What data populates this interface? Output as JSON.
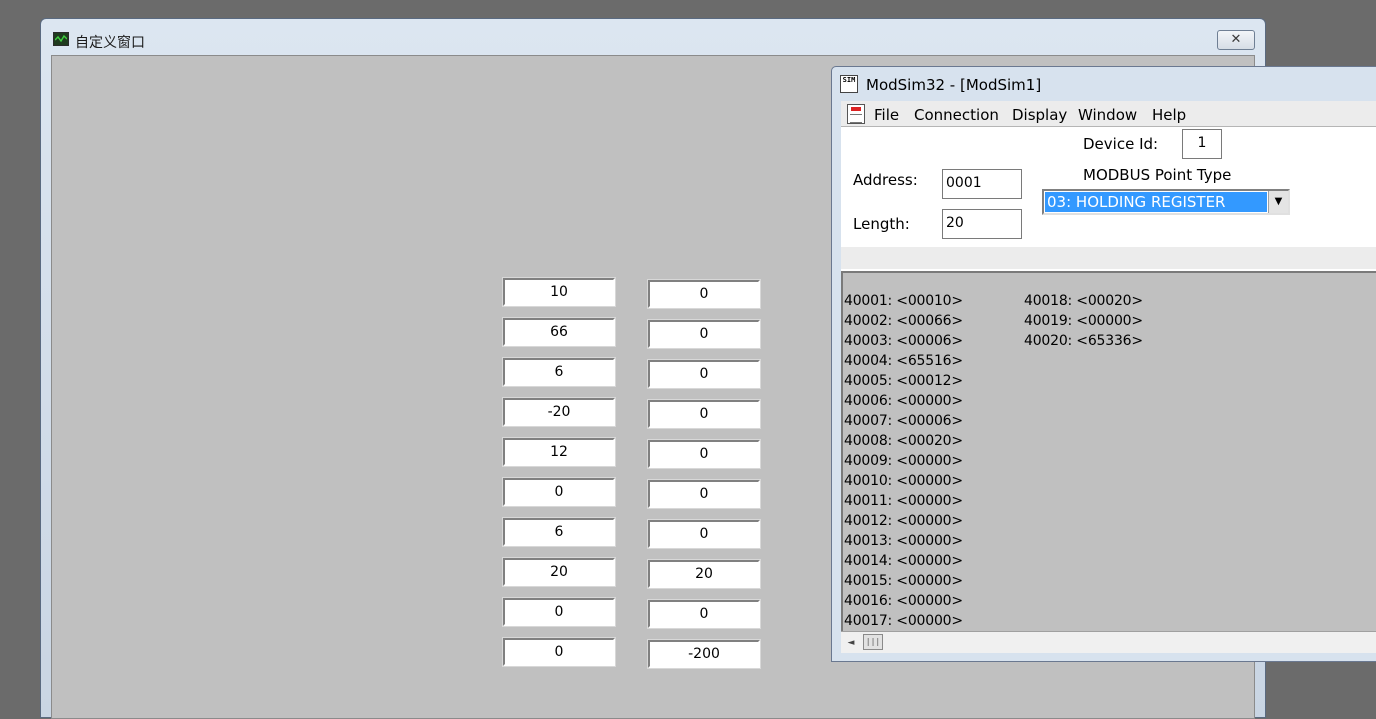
{
  "custom_window": {
    "title": "自定义窗口",
    "close_glyph": "✕",
    "column_a": [
      "10",
      "66",
      "6",
      "-20",
      "12",
      "0",
      "6",
      "20",
      "0",
      "0"
    ],
    "column_b": [
      "0",
      "0",
      "0",
      "0",
      "0",
      "0",
      "0",
      "20",
      "0",
      "-200"
    ]
  },
  "modsim": {
    "title": "ModSim32 - [ModSim1]",
    "icon_text": "SIM",
    "menu": [
      "File",
      "Connection",
      "Display",
      "Window",
      "Help"
    ],
    "device_id_label": "Device Id:",
    "device_id_value": "1",
    "address_label": "Address:",
    "address_value": "0001",
    "length_label": "Length:",
    "length_value": "20",
    "point_type_label": "MODBUS Point Type",
    "point_type_value": "03: HOLDING REGISTER",
    "dropdown_arrow": "▼",
    "registers_col1": [
      "40001: <00010>",
      "40002: <00066>",
      "40003: <00006>",
      "40004: <65516>",
      "40005: <00012>",
      "40006: <00000>",
      "40007: <00006>",
      "40008: <00020>",
      "40009: <00000>",
      "40010: <00000>",
      "40011: <00000>",
      "40012: <00000>",
      "40013: <00000>",
      "40014: <00000>",
      "40015: <00000>",
      "40016: <00000>",
      "40017: <00000>"
    ],
    "registers_col2": [
      "40018: <00020>",
      "40019: <00000>",
      "40020: <65336>"
    ],
    "scroll_left_glyph": "◄",
    "scroll_thumb_glyph": "|||"
  }
}
